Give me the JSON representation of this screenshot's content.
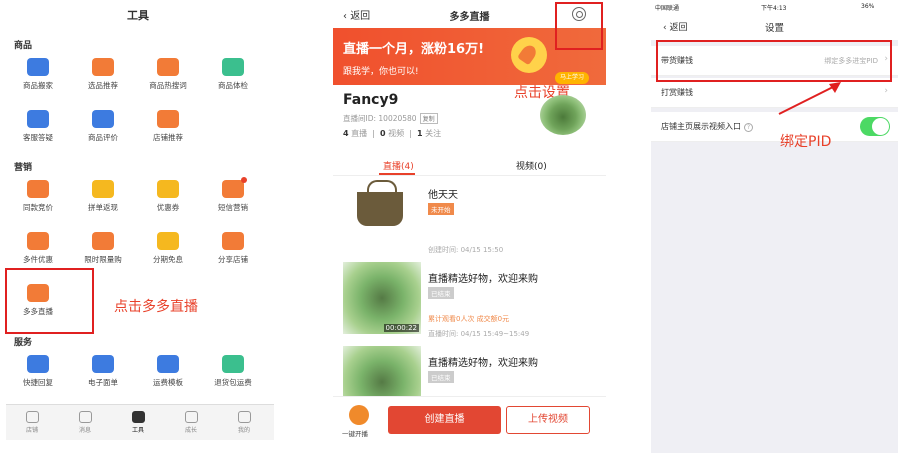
{
  "panel1": {
    "title": "工具",
    "sections": {
      "goods": "商品",
      "marketing": "营销",
      "service": "服务"
    },
    "goods_items": [
      {
        "label": "商品搬家",
        "icon": "truck-icon",
        "color": "#3d7be0"
      },
      {
        "label": "选品推荐",
        "icon": "grid-search-icon",
        "color": "#f27b37"
      },
      {
        "label": "商品热搜词",
        "icon": "magnifier-icon",
        "color": "#f27b37"
      },
      {
        "label": "商品体检",
        "icon": "shopping-bag-icon",
        "color": "#3bbf8e"
      },
      {
        "label": "客服答疑",
        "icon": "chat-icon",
        "color": "#3d7be0"
      },
      {
        "label": "商品评价",
        "icon": "comment-dots-icon",
        "color": "#3d7be0"
      },
      {
        "label": "店铺推荐",
        "icon": "thumbs-up-icon",
        "color": "#f27b37"
      }
    ],
    "marketing_items": [
      {
        "label": "同款竞价",
        "icon": "bag-icon",
        "color": "#f27b37"
      },
      {
        "label": "拼单返现",
        "icon": "coin-icon",
        "color": "#f5b81f"
      },
      {
        "label": "优惠券",
        "icon": "coupon-icon",
        "color": "#f5b81f"
      },
      {
        "label": "短信营销",
        "icon": "message-icon",
        "color": "#f27b37",
        "dot": true
      },
      {
        "label": "多件优惠",
        "icon": "discount-icon",
        "color": "#f27b37"
      },
      {
        "label": "限时限量购",
        "icon": "clock-icon",
        "color": "#f27b37"
      },
      {
        "label": "分期免息",
        "icon": "card-icon",
        "color": "#f5b81f"
      },
      {
        "label": "分享店铺",
        "icon": "home-share-icon",
        "color": "#f27b37"
      },
      {
        "label": "多多直播",
        "icon": "video-camera-icon",
        "color": "#f27b37"
      }
    ],
    "service_items": [
      {
        "label": "快捷回复",
        "icon": "reply-icon",
        "color": "#3d7be0"
      },
      {
        "label": "电子面单",
        "icon": "document-icon",
        "color": "#3d7be0"
      },
      {
        "label": "运费模板",
        "icon": "delivery-truck-icon",
        "color": "#3d7be0"
      },
      {
        "label": "退货包运费",
        "icon": "return-icon",
        "color": "#3bbf8e"
      }
    ],
    "note": "点击多多直播",
    "tabs": [
      {
        "label": "店铺",
        "icon": "store-icon"
      },
      {
        "label": "消息",
        "icon": "message-tab-icon"
      },
      {
        "label": "工具",
        "icon": "tools-tab-icon",
        "active": true
      },
      {
        "label": "成长",
        "icon": "growth-tab-icon"
      },
      {
        "label": "我的",
        "icon": "profile-tab-icon"
      }
    ]
  },
  "panel2": {
    "back": "返回",
    "title": "多多直播",
    "banner_line1": "直播一个月，涨粉16万!",
    "banner_line2": "跟我学，你也可以!",
    "banner_button": "马上学习",
    "settings_note": "点击设置",
    "user_name": "Fancy9",
    "room_id": "直播间ID: 10020580",
    "copy": "复制",
    "stats": {
      "live_count": "4",
      "live_label": "直播",
      "video_count": "0",
      "video_label": "视频",
      "follow_count": "1",
      "follow_label": "关注"
    },
    "tabs": [
      {
        "label": "直播(4)",
        "active": true
      },
      {
        "label": "视频(0)",
        "active": false
      }
    ],
    "items": [
      {
        "title": "他天天",
        "status": "未开始",
        "status_style": "orange",
        "extra": "",
        "time": "创建时间: 04/15 15:50",
        "thumb": "bag",
        "duration": ""
      },
      {
        "title": "直播精选好物，欢迎来购",
        "status": "已结束",
        "status_style": "gray",
        "extra": "累计观看0人次  成交额0元",
        "time": "直播时间: 04/15 15:49~15:49",
        "thumb": "green",
        "duration": "00:00:22"
      },
      {
        "title": "直播精选好物，欢迎来购",
        "status": "已结束",
        "status_style": "gray",
        "extra": "",
        "time": "",
        "thumb": "green",
        "duration": ""
      }
    ],
    "bottom": {
      "camera_label": "一键开播",
      "create": "创建直播",
      "upload": "上传视频"
    }
  },
  "panel3": {
    "status": {
      "carrier": "中国联通",
      "time": "下午4:13",
      "battery": "36%"
    },
    "back": "返回",
    "title": "设置",
    "rows": [
      {
        "label": "带货赚钱",
        "value": "绑定多多进宝PID",
        "chevron": true
      },
      {
        "label": "打赏赚钱",
        "value": "",
        "chevron": true
      },
      {
        "label": "店铺主页展示视频入口",
        "value": "",
        "toggle": true
      }
    ],
    "note": "绑定PID"
  }
}
